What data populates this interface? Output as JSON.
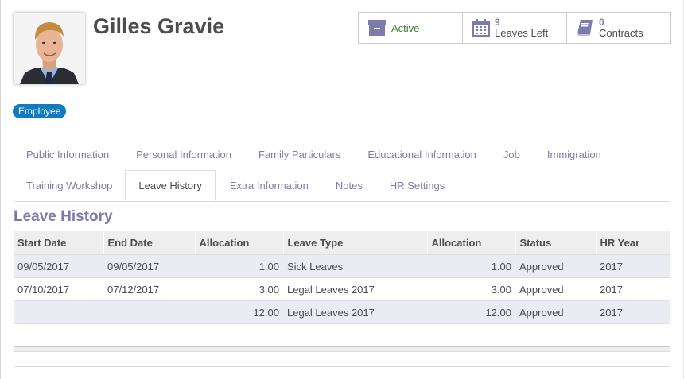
{
  "employee": {
    "name": "Gilles Gravie",
    "tag": "Employee"
  },
  "stats": {
    "active_label": "Active",
    "leaves_value": "9",
    "leaves_label": "Leaves Left",
    "contracts_value": "0",
    "contracts_label": "Contracts"
  },
  "tabs": [
    {
      "label": "Public Information"
    },
    {
      "label": "Personal Information"
    },
    {
      "label": "Family Particulars"
    },
    {
      "label": "Educational Information"
    },
    {
      "label": "Job"
    },
    {
      "label": "Immigration"
    },
    {
      "label": "Training Workshop"
    },
    {
      "label": "Leave History"
    },
    {
      "label": "Extra Information"
    },
    {
      "label": "Notes"
    },
    {
      "label": "HR Settings"
    }
  ],
  "active_tab": "Leave History",
  "section_title": "Leave History",
  "table": {
    "headers": [
      "Start Date",
      "End Date",
      "Allocation",
      "Leave Type",
      "Allocation",
      "Status",
      "HR Year"
    ],
    "rows": [
      [
        "09/05/2017",
        "09/05/2017",
        "1.00",
        "Sick Leaves",
        "1.00",
        "Approved",
        "2017"
      ],
      [
        "07/10/2017",
        "07/12/2017",
        "3.00",
        "Legal Leaves 2017",
        "3.00",
        "Approved",
        "2017"
      ],
      [
        "",
        "",
        "12.00",
        "Legal Leaves 2017",
        "12.00",
        "Approved",
        "2017"
      ]
    ]
  },
  "colors": {
    "accent": "#7c7bad",
    "tag": "#0f7cbf",
    "active_green": "#3f7f2f"
  },
  "icons": [
    "archive-box-icon",
    "calendar-icon",
    "book-icon"
  ]
}
